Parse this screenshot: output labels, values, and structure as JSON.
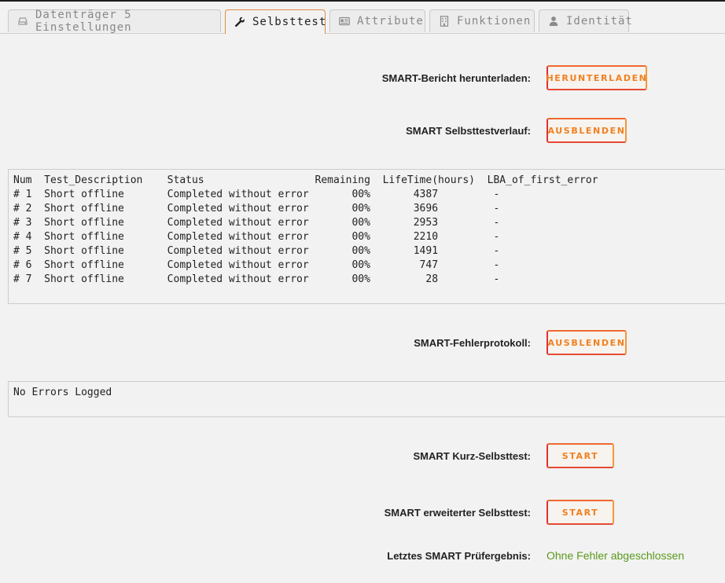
{
  "tabs": [
    {
      "label": "Datenträger 5 Einstellungen",
      "icon": "hdd-icon",
      "active": false
    },
    {
      "label": "Selbsttest",
      "icon": "wrench-icon",
      "active": true
    },
    {
      "label": "Attribute",
      "icon": "id-card-icon",
      "active": false
    },
    {
      "label": "Funktionen",
      "icon": "building-icon",
      "active": false
    },
    {
      "label": "Identität",
      "icon": "user-icon",
      "active": false
    }
  ],
  "report": {
    "label": "SMART-Bericht herunterladen:",
    "button": "HERUNTERLADEN"
  },
  "selftest_log": {
    "label": "SMART Selbsttestverlauf:",
    "button": "AUSBLENDEN",
    "columns": [
      "Num",
      "Test_Description",
      "Status",
      "Remaining",
      "LifeTime(hours)",
      "LBA_of_first_error"
    ],
    "rows": [
      [
        "# 1",
        "Short offline",
        "Completed without error",
        "00%",
        "4387",
        "-"
      ],
      [
        "# 2",
        "Short offline",
        "Completed without error",
        "00%",
        "3696",
        "-"
      ],
      [
        "# 3",
        "Short offline",
        "Completed without error",
        "00%",
        "2953",
        "-"
      ],
      [
        "# 4",
        "Short offline",
        "Completed without error",
        "00%",
        "2210",
        "-"
      ],
      [
        "# 5",
        "Short offline",
        "Completed without error",
        "00%",
        "1491",
        "-"
      ],
      [
        "# 6",
        "Short offline",
        "Completed without error",
        "00%",
        "747",
        "-"
      ],
      [
        "# 7",
        "Short offline",
        "Completed without error",
        "00%",
        "28",
        "-"
      ]
    ]
  },
  "error_log": {
    "label": "SMART-Fehlerprotokoll:",
    "button": "AUSBLENDEN",
    "text": "No Errors Logged"
  },
  "short_test": {
    "label": "SMART Kurz-Selbsttest:",
    "button": "START"
  },
  "extended_test": {
    "label": "SMART erweiterter Selbsttest:",
    "button": "START"
  },
  "last_result": {
    "label": "Letztes SMART Prüfergebnis:",
    "value": "Ohne Fehler abgeschlossen"
  },
  "colors": {
    "accent": "#f0801f",
    "button_border": "#e53935",
    "success": "#5b9a1c"
  }
}
